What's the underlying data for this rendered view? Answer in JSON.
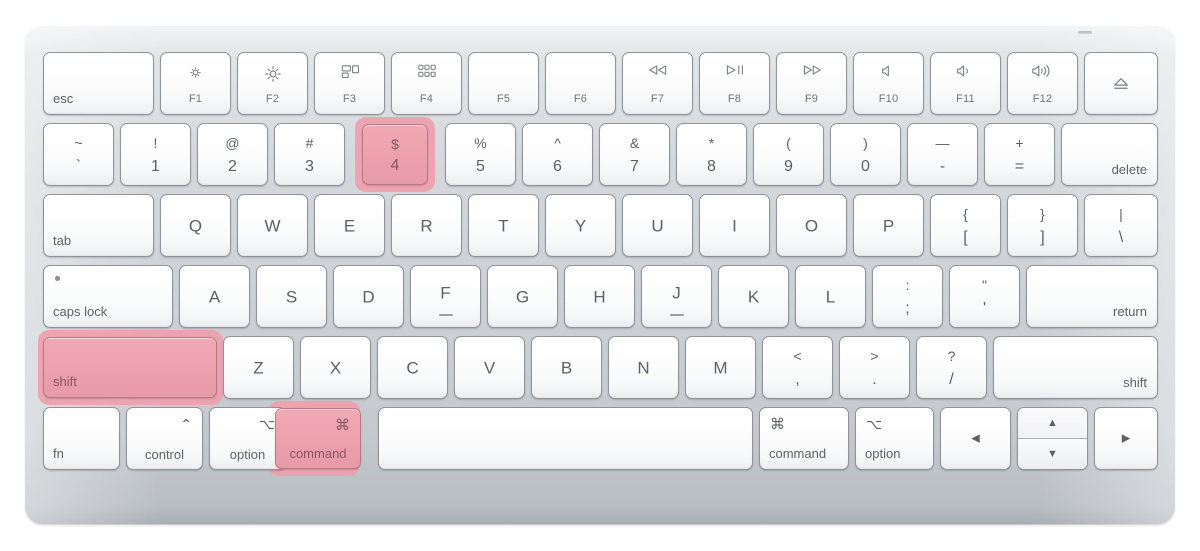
{
  "device": {
    "name": "Apple Magic Keyboard",
    "body_color": "#cdd0d4",
    "key_color": "#ffffff",
    "key_border_color": "#8f959b",
    "label_color": "#5d6166",
    "highlight_fill": "#eda2ae",
    "highlight_glow": "#eda0ac",
    "highlight_border": "#bd7782",
    "highlight_label_color": "#8d5560"
  },
  "highlighted_keys": [
    "shift",
    "command",
    "4"
  ],
  "shortcut": "shift + command + 4",
  "rows": {
    "function_row": [
      {
        "name": "esc",
        "label": "esc",
        "icon": "",
        "sub": "",
        "align": "bottom-left"
      },
      {
        "name": "f1",
        "label": "",
        "icon": "brightness-low",
        "sub": "F1",
        "align": "icon-top"
      },
      {
        "name": "f2",
        "label": "",
        "icon": "brightness-high",
        "sub": "F2",
        "align": "icon-top"
      },
      {
        "name": "f3",
        "label": "",
        "icon": "mission-control",
        "sub": "F3",
        "align": "icon-top"
      },
      {
        "name": "f4",
        "label": "",
        "icon": "launchpad",
        "sub": "F4",
        "align": "icon-top"
      },
      {
        "name": "f5",
        "label": "",
        "icon": "",
        "sub": "F5",
        "align": "icon-top"
      },
      {
        "name": "f6",
        "label": "",
        "icon": "",
        "sub": "F6",
        "align": "icon-top"
      },
      {
        "name": "f7",
        "label": "",
        "icon": "rewind",
        "sub": "F7",
        "align": "icon-top"
      },
      {
        "name": "f8",
        "label": "",
        "icon": "play-pause",
        "sub": "F8",
        "align": "icon-top"
      },
      {
        "name": "f9",
        "label": "",
        "icon": "fast-forward",
        "sub": "F9",
        "align": "icon-top"
      },
      {
        "name": "f10",
        "label": "",
        "icon": "volume-mute",
        "sub": "F10",
        "align": "icon-top"
      },
      {
        "name": "f11",
        "label": "",
        "icon": "volume-down",
        "sub": "F11",
        "align": "icon-top"
      },
      {
        "name": "f12",
        "label": "",
        "icon": "volume-up",
        "sub": "F12",
        "align": "icon-top"
      },
      {
        "name": "eject",
        "label": "",
        "icon": "eject",
        "sub": "",
        "align": "icon-center"
      }
    ],
    "number_row": [
      {
        "name": "grave",
        "top": "~",
        "bottom": "`"
      },
      {
        "name": "1",
        "top": "!",
        "bottom": "1"
      },
      {
        "name": "2",
        "top": "@",
        "bottom": "2"
      },
      {
        "name": "3",
        "top": "#",
        "bottom": "3"
      },
      {
        "name": "4",
        "top": "$",
        "bottom": "4",
        "highlighted": true
      },
      {
        "name": "5",
        "top": "%",
        "bottom": "5"
      },
      {
        "name": "6",
        "top": "^",
        "bottom": "6"
      },
      {
        "name": "7",
        "top": "&",
        "bottom": "7"
      },
      {
        "name": "8",
        "top": "*",
        "bottom": "8"
      },
      {
        "name": "9",
        "top": "(",
        "bottom": "9"
      },
      {
        "name": "0",
        "top": ")",
        "bottom": "0"
      },
      {
        "name": "minus",
        "top": "—",
        "bottom": "-"
      },
      {
        "name": "equal",
        "top": "+",
        "bottom": "="
      },
      {
        "name": "delete",
        "label": "delete",
        "align": "bottom-right"
      }
    ],
    "top_row": [
      {
        "name": "tab",
        "label": "tab",
        "align": "bottom-left"
      },
      {
        "name": "q",
        "label": "Q"
      },
      {
        "name": "w",
        "label": "W"
      },
      {
        "name": "e",
        "label": "E"
      },
      {
        "name": "r",
        "label": "R"
      },
      {
        "name": "t",
        "label": "T"
      },
      {
        "name": "y",
        "label": "Y"
      },
      {
        "name": "u",
        "label": "U"
      },
      {
        "name": "i",
        "label": "I"
      },
      {
        "name": "o",
        "label": "O"
      },
      {
        "name": "p",
        "label": "P"
      },
      {
        "name": "bracket-left",
        "top": "{",
        "bottom": "["
      },
      {
        "name": "bracket-right",
        "top": "}",
        "bottom": "]"
      },
      {
        "name": "backslash",
        "top": "|",
        "bottom": "\\"
      }
    ],
    "home_row": [
      {
        "name": "caps-lock",
        "label": "caps lock",
        "align": "bottom-left",
        "led": true
      },
      {
        "name": "a",
        "label": "A"
      },
      {
        "name": "s",
        "label": "S"
      },
      {
        "name": "d",
        "label": "D"
      },
      {
        "name": "f",
        "label": "F",
        "bump": true
      },
      {
        "name": "g",
        "label": "G"
      },
      {
        "name": "h",
        "label": "H"
      },
      {
        "name": "j",
        "label": "J",
        "bump": true
      },
      {
        "name": "k",
        "label": "K"
      },
      {
        "name": "l",
        "label": "L"
      },
      {
        "name": "semicolon",
        "top": ":",
        "bottom": ";"
      },
      {
        "name": "quote",
        "top": "\"",
        "bottom": "'"
      },
      {
        "name": "return",
        "label": "return",
        "align": "bottom-right"
      }
    ],
    "bottom_letter_row": [
      {
        "name": "shift-left",
        "label": "shift",
        "align": "bottom-left",
        "highlighted": true
      },
      {
        "name": "z",
        "label": "Z"
      },
      {
        "name": "x",
        "label": "X"
      },
      {
        "name": "c",
        "label": "C"
      },
      {
        "name": "v",
        "label": "V"
      },
      {
        "name": "b",
        "label": "B"
      },
      {
        "name": "n",
        "label": "N"
      },
      {
        "name": "m",
        "label": "M"
      },
      {
        "name": "comma",
        "top": "<",
        "bottom": ","
      },
      {
        "name": "period",
        "top": ">",
        "bottom": "."
      },
      {
        "name": "slash",
        "top": "?",
        "bottom": "/"
      },
      {
        "name": "shift-right",
        "label": "shift",
        "align": "bottom-right"
      }
    ],
    "modifier_row": [
      {
        "name": "fn",
        "label": "fn",
        "glyph": "",
        "align": "bottom-left"
      },
      {
        "name": "control",
        "label": "control",
        "glyph": "⌃",
        "align": "glyph-top-right"
      },
      {
        "name": "option-left",
        "label": "option",
        "glyph": "⌥",
        "align": "glyph-top-right"
      },
      {
        "name": "command-left",
        "label": "command",
        "glyph": "⌘",
        "align": "glyph-top-right",
        "highlighted": true
      },
      {
        "name": "space",
        "label": "",
        "glyph": ""
      },
      {
        "name": "command-right",
        "label": "command",
        "glyph": "⌘",
        "align": "glyph-top-left"
      },
      {
        "name": "option-right",
        "label": "option",
        "glyph": "⌥",
        "align": "glyph-top-left"
      },
      {
        "name": "arrow-left",
        "label": "◀"
      },
      {
        "name": "arrow-up-down",
        "up": "▲",
        "down": "▼"
      },
      {
        "name": "arrow-right",
        "label": "▶"
      }
    ]
  }
}
